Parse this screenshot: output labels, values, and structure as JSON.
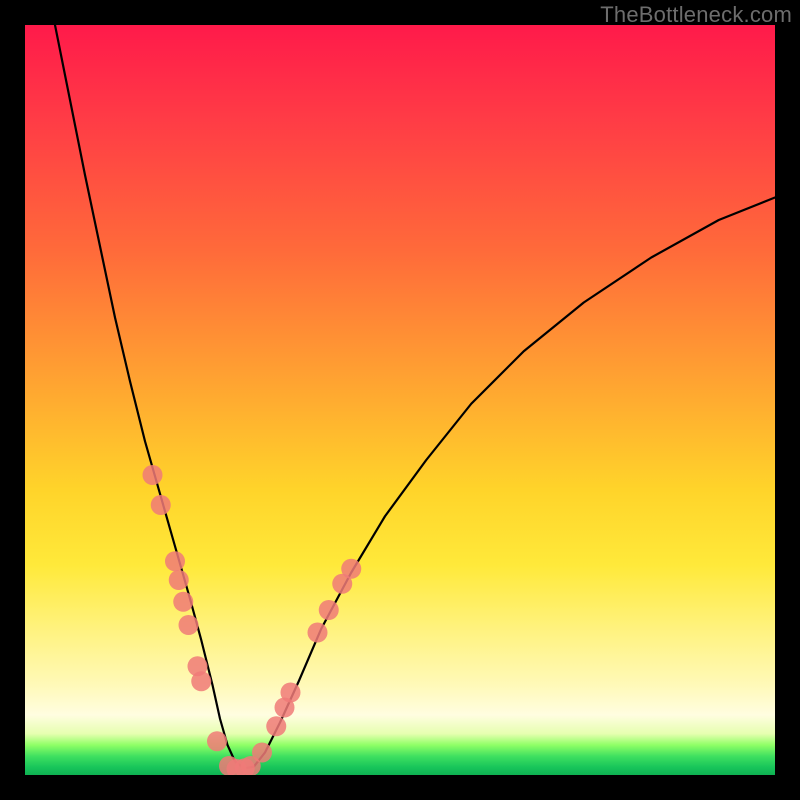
{
  "watermark": "TheBottleneck.com",
  "chart_data": {
    "type": "line",
    "title": "",
    "xlabel": "",
    "ylabel": "",
    "xlim": [
      0,
      100
    ],
    "ylim": [
      0,
      100
    ],
    "series": [
      {
        "name": "bottleneck-curve",
        "x": [
          4.0,
          6.0,
          8.0,
          10.0,
          12.0,
          14.0,
          16.0,
          18.0,
          20.0,
          22.0,
          23.5,
          25.0,
          26.0,
          27.0,
          28.0,
          29.2,
          30.5,
          32.0,
          34.0,
          36.5,
          39.5,
          43.5,
          48.0,
          53.5,
          59.5,
          66.5,
          74.5,
          83.5,
          92.5,
          100.0
        ],
        "y": [
          100.0,
          90.0,
          80.0,
          70.5,
          61.0,
          52.5,
          44.5,
          37.5,
          30.5,
          23.5,
          18.0,
          12.0,
          7.5,
          4.0,
          1.8,
          0.9,
          1.1,
          3.0,
          7.0,
          12.5,
          19.5,
          27.0,
          34.5,
          42.0,
          49.5,
          56.5,
          63.0,
          69.0,
          74.0,
          77.0
        ]
      }
    ],
    "points": {
      "name": "highlighted-points",
      "coords": [
        [
          17.0,
          40.0
        ],
        [
          18.1,
          36.0
        ],
        [
          20.0,
          28.5
        ],
        [
          20.5,
          26.0
        ],
        [
          21.1,
          23.1
        ],
        [
          21.8,
          20.0
        ],
        [
          23.0,
          14.5
        ],
        [
          23.5,
          12.5
        ],
        [
          25.6,
          4.5
        ],
        [
          27.2,
          1.2
        ],
        [
          28.2,
          0.8
        ],
        [
          29.3,
          0.9
        ],
        [
          30.1,
          1.2
        ],
        [
          31.6,
          3.0
        ],
        [
          33.5,
          6.5
        ],
        [
          34.6,
          9.0
        ],
        [
          35.4,
          11.0
        ],
        [
          39.0,
          19.0
        ],
        [
          40.5,
          22.0
        ],
        [
          42.3,
          25.5
        ],
        [
          43.5,
          27.5
        ]
      ]
    },
    "background_gradient": {
      "top": "#ff1a4a",
      "mid": "#ffd42a",
      "lower_band": "#fffde0",
      "bottom": "#0fb152"
    }
  }
}
